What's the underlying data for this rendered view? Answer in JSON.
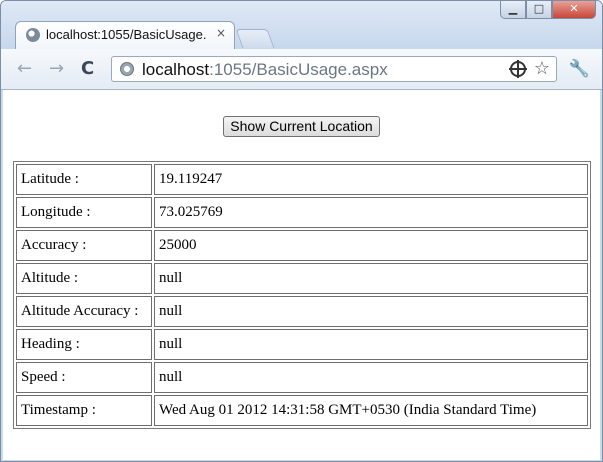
{
  "browser": {
    "tab_title": "localhost:1055/BasicUsage.",
    "tab_close": "×",
    "url_host": "localhost",
    "url_rest": ":1055/BasicUsage.aspx",
    "back_glyph": "←",
    "forward_glyph": "→",
    "reload_glyph": "C",
    "star_glyph": "☆",
    "wrench_glyph": "🔧",
    "minimize_glyph": "▁",
    "maximize_glyph": "□",
    "close_glyph": "✕"
  },
  "page": {
    "button_label": "Show Current Location",
    "rows": [
      {
        "label": "Latitude :",
        "value": "19.119247"
      },
      {
        "label": "Longitude :",
        "value": "73.025769"
      },
      {
        "label": "Accuracy :",
        "value": "25000"
      },
      {
        "label": "Altitude :",
        "value": "null"
      },
      {
        "label": "Altitude Accuracy :",
        "value": "null"
      },
      {
        "label": "Heading :",
        "value": "null"
      },
      {
        "label": "Speed :",
        "value": "null"
      },
      {
        "label": "Timestamp :",
        "value": "Wed Aug 01 2012 14:31:58 GMT+0530 (India Standard Time)"
      }
    ]
  },
  "icons": {
    "favicon": "globe-icon",
    "page_icon": "page-icon",
    "location": "crosshair-icon",
    "bookmark": "star-icon",
    "menu": "wrench-icon"
  }
}
